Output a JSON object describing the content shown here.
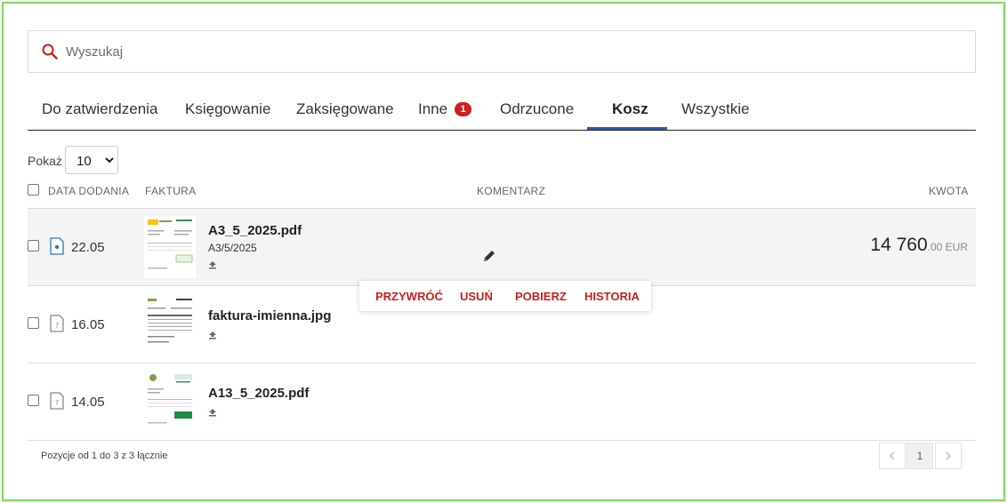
{
  "search": {
    "placeholder": "Wyszukaj"
  },
  "tabs": [
    {
      "label": "Do zatwierdzenia"
    },
    {
      "label": "Księgowanie"
    },
    {
      "label": "Zaksięgowane"
    },
    {
      "label": "Inne",
      "badge": "1"
    },
    {
      "label": "Odrzucone"
    },
    {
      "label": "Kosz",
      "active": true
    },
    {
      "label": "Wszystkie"
    }
  ],
  "show": {
    "label": "Pokaż",
    "value": "10"
  },
  "table": {
    "headers": {
      "date": "DATA DODANIA",
      "invoice": "FAKTURA",
      "comment": "KOMENTARZ",
      "amount": "KWOTA"
    },
    "rows": [
      {
        "date": "22.05",
        "file": "A3_5_2025.pdf",
        "number": "A3/5/2025",
        "amount_main": "14 760",
        "amount_dec": ".00",
        "currency": "EUR"
      },
      {
        "date": "16.05",
        "file": "faktura-imienna.jpg"
      },
      {
        "date": "14.05",
        "file": "A13_5_2025.pdf"
      }
    ]
  },
  "actions": {
    "restore": "PRZYWRÓĆ",
    "delete": "USUŃ",
    "download": "POBIERZ",
    "history": "HISTORIA"
  },
  "footer": {
    "summary": "Pozycje od 1 do 3 z 3 łącznie",
    "page": "1"
  },
  "colors": {
    "accent": "#c8211c",
    "tab_underline": "#2a5ea8",
    "frame": "#7ed957"
  }
}
